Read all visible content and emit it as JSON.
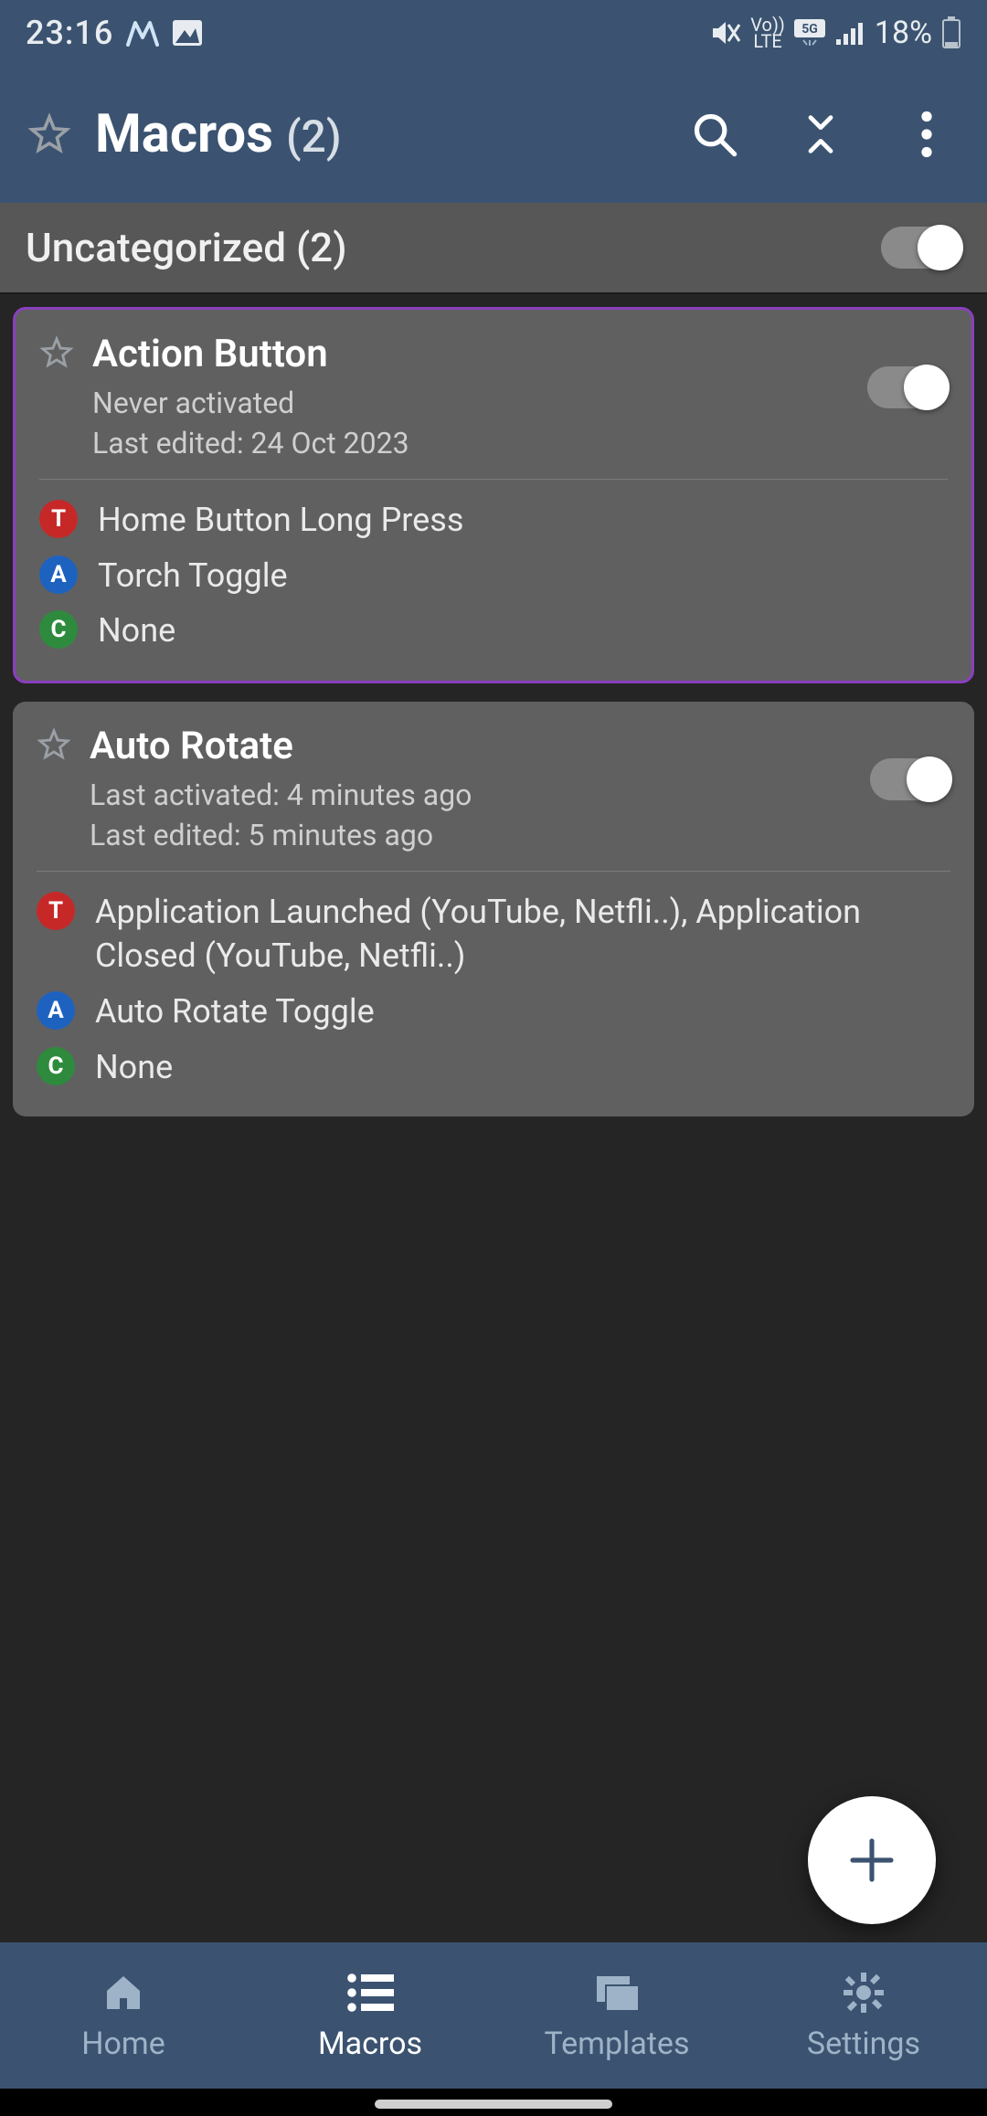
{
  "status": {
    "time": "23:16",
    "icons_left": [
      "m-icon",
      "picture-icon"
    ],
    "icons_right": [
      "mute-icon",
      "volte-icon",
      "5g-icon",
      "signal-icon"
    ],
    "battery_pct": "18%"
  },
  "appbar": {
    "title": "Macros",
    "count": "(2)"
  },
  "category": {
    "name": "Uncategorized (2)",
    "enabled": true
  },
  "macros": [
    {
      "highlight": true,
      "title": "Action Button",
      "meta1": "Never activated",
      "meta2": "Last edited: 24 Oct 2023",
      "enabled": true,
      "trigger": "Home Button Long Press",
      "action": "Torch Toggle",
      "constraint": "None"
    },
    {
      "highlight": false,
      "title": "Auto Rotate",
      "meta1": "Last activated: 4 minutes ago",
      "meta2": "Last edited: 5 minutes ago",
      "enabled": true,
      "trigger": "Application Launched (YouTube, Netfli..), Application Closed (YouTube, Netfli..)",
      "action": "Auto Rotate Toggle",
      "constraint": "None"
    }
  ],
  "bottomnav": {
    "items": [
      {
        "label": "Home",
        "icon": "home"
      },
      {
        "label": "Macros",
        "icon": "list"
      },
      {
        "label": "Templates",
        "icon": "cards"
      },
      {
        "label": "Settings",
        "icon": "gear"
      }
    ],
    "active_index": 1
  },
  "badges": {
    "T": "T",
    "A": "A",
    "C": "C"
  }
}
